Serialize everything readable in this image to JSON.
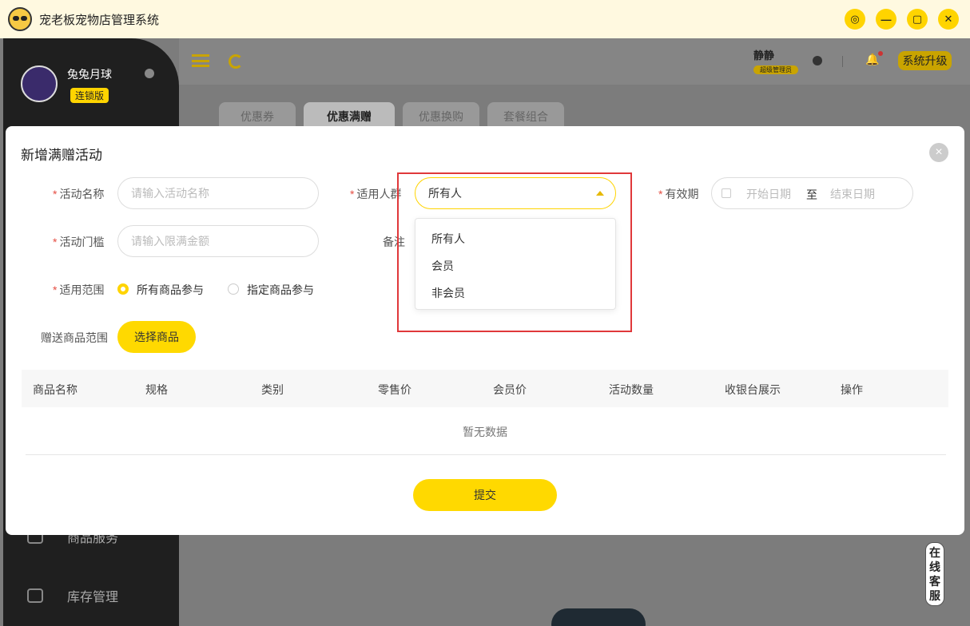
{
  "app": {
    "title": "宠老板宠物店管理系统"
  },
  "window_controls": [
    "◎",
    "—",
    "▢",
    "✕"
  ],
  "sidebar": {
    "store_name": "兔兔月球",
    "edition": "连锁版",
    "items": [
      {
        "label": "商品服务",
        "icon": "box-icon"
      },
      {
        "label": "库存管理",
        "icon": "inventory-icon"
      }
    ]
  },
  "topbar": {
    "user_name": "静静",
    "user_role": "超级管理员",
    "upgrade_label": "系统升级"
  },
  "background_tabs": [
    "优惠券",
    "优惠满赠",
    "优惠换购",
    "套餐组合"
  ],
  "modal": {
    "title": "新增满赠活动",
    "fields": {
      "activity_name": {
        "label": "活动名称",
        "placeholder": "请输入活动名称"
      },
      "audience": {
        "label": "适用人群",
        "value": "所有人"
      },
      "validity": {
        "label": "有效期",
        "start_placeholder": "开始日期",
        "separator": "至",
        "end_placeholder": "结束日期"
      },
      "threshold": {
        "label": "活动门槛",
        "placeholder": "请输入限满金额"
      },
      "remark": {
        "label": "备注"
      },
      "scope": {
        "label": "适用范围",
        "options": [
          "所有商品参与",
          "指定商品参与"
        ],
        "selected": "所有商品参与"
      },
      "gift_scope": {
        "label": "赠送商品范围",
        "button": "选择商品"
      }
    },
    "table": {
      "columns": [
        "商品名称",
        "规格",
        "类别",
        "零售价",
        "会员价",
        "活动数量",
        "收银台展示",
        "操作"
      ],
      "empty_text": "暂无数据"
    },
    "submit_label": "提交"
  },
  "dropdown": {
    "options": [
      "所有人",
      "会员",
      "非会员"
    ]
  },
  "online_service": [
    "在",
    "线",
    "客",
    "服"
  ],
  "colors": {
    "accent": "#ffd900",
    "highlight_border": "#e0383a",
    "required": "#e54d42"
  }
}
